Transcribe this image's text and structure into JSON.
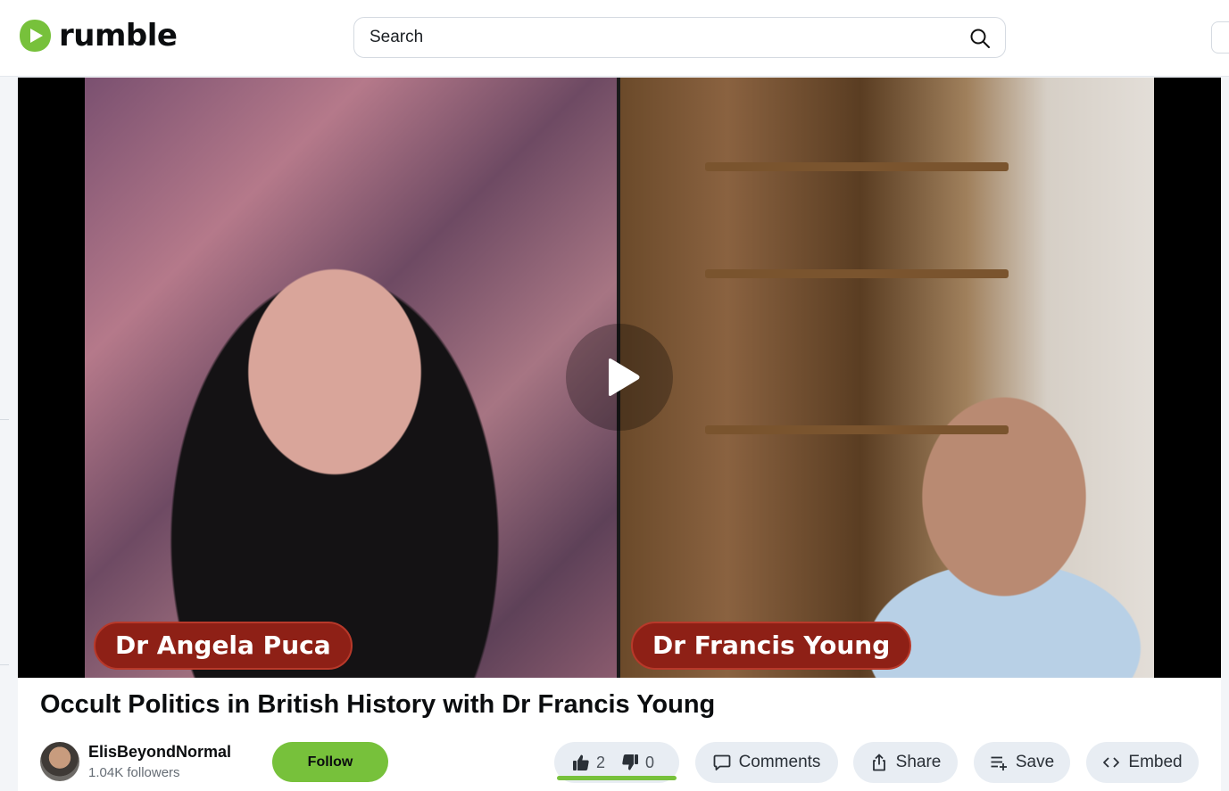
{
  "header": {
    "brand": "rumble",
    "search_placeholder": "Search",
    "icons": [
      "rumble-logo-icon",
      "search-icon"
    ]
  },
  "video": {
    "left_name_tag": "Dr Angela Puca",
    "right_name_tag": "Dr Francis Young",
    "play_icon": "play-icon"
  },
  "info": {
    "title": "Occult Politics in British History with Dr Francis Young",
    "channel_name": "ElisBeyondNormal",
    "channel_followers": "1.04K followers",
    "follow_label": "Follow",
    "likes": "2",
    "dislikes": "0",
    "like_ratio": 1.0,
    "comments_label": "Comments",
    "share_label": "Share",
    "save_label": "Save",
    "embed_label": "Embed"
  },
  "colors": {
    "brand_green": "#77c13b",
    "name_tag_red": "#8e2016",
    "pill_gray": "#e8edf3"
  }
}
